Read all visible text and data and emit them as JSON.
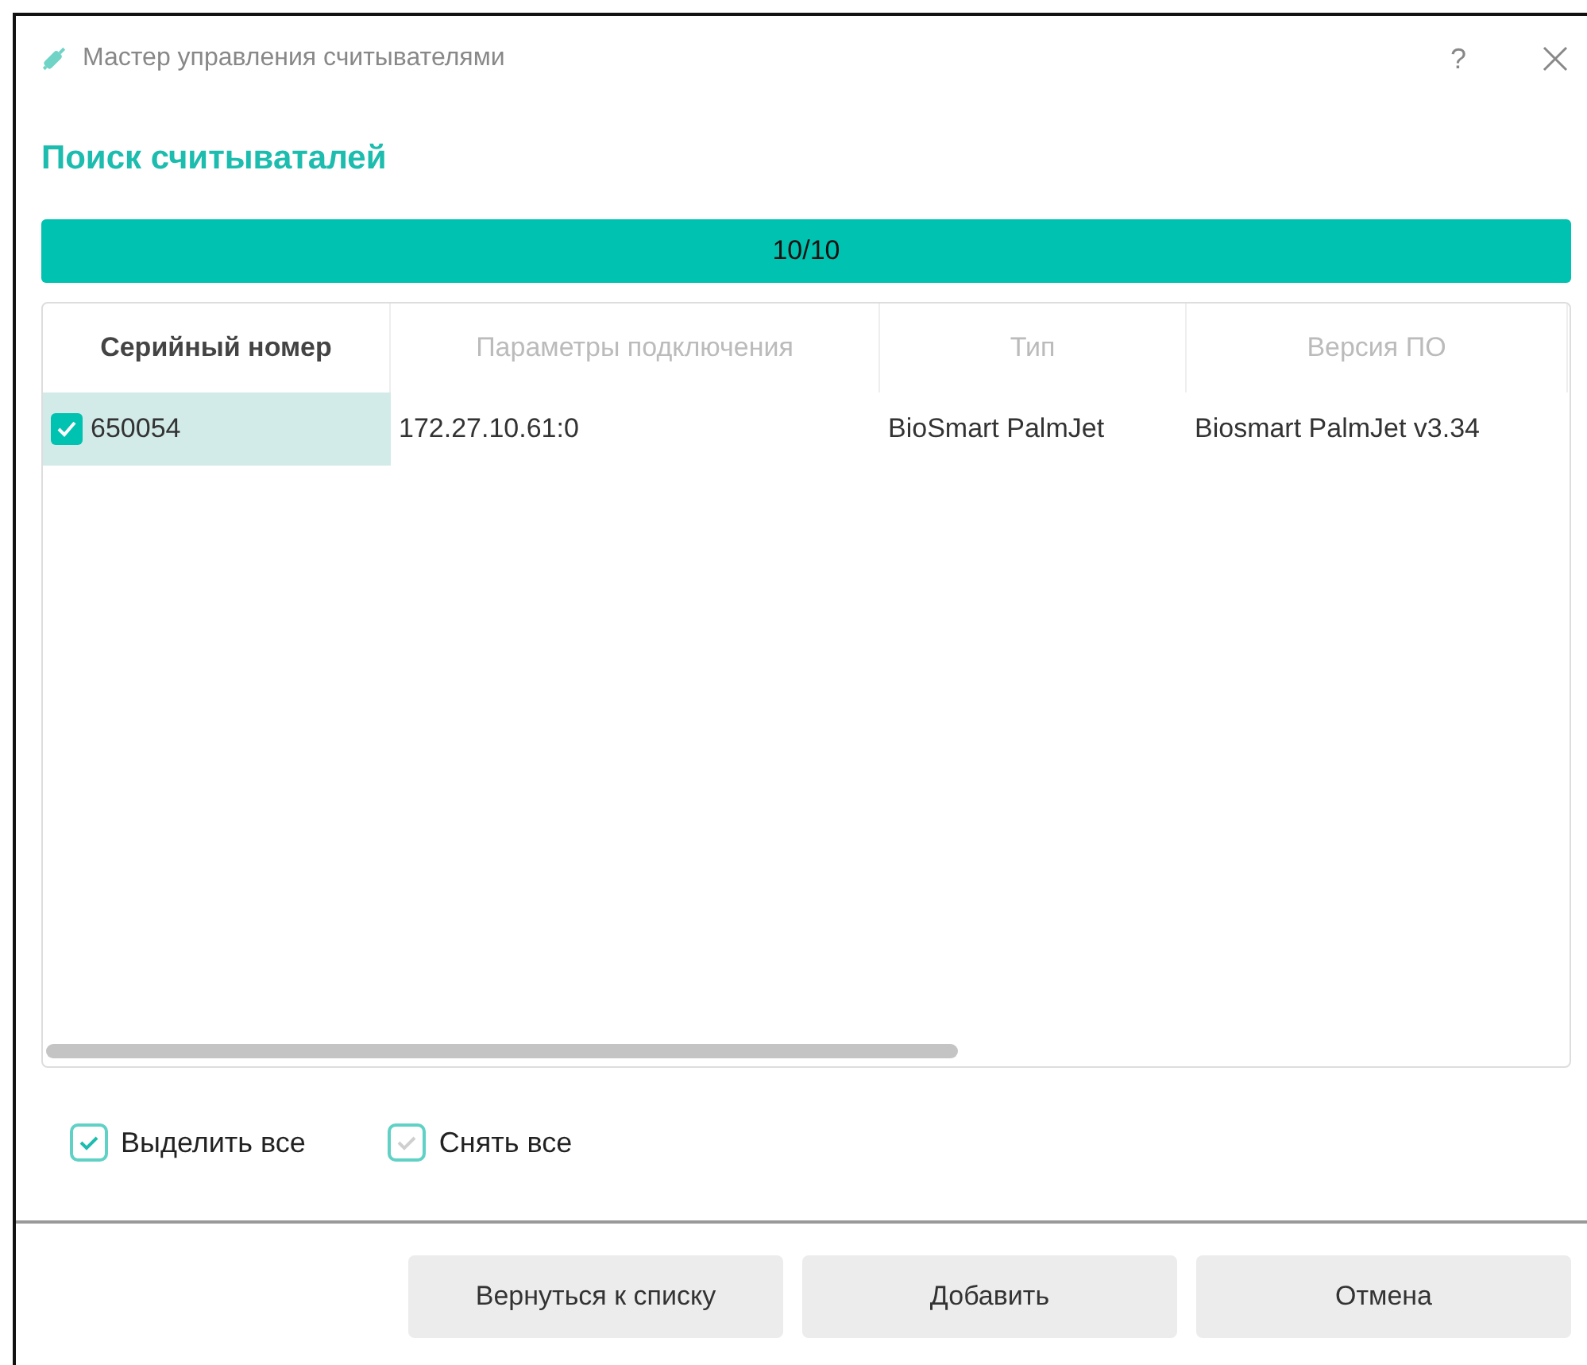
{
  "window": {
    "title": "Мастер управления считывателями",
    "help": "?"
  },
  "heading": "Поиск считываталей",
  "progress": {
    "level": 1,
    "reading": "10/10"
  },
  "table": {
    "columns": [
      {
        "label": "Серийный номер",
        "selected": true
      },
      {
        "label": "Параметры подключения",
        "selected": false
      },
      {
        "label": "Тип",
        "selected": false
      },
      {
        "label": "Версия ПО",
        "selected": false
      }
    ],
    "rows": [
      {
        "checked": true,
        "selected": true,
        "cells": [
          "650054",
          "172.27.10.61:0",
          "BioSmart PalmJet",
          "Biosmart PalmJet v3.34"
        ]
      }
    ]
  },
  "options": [
    {
      "label": "Выделить все",
      "disabled": false
    },
    {
      "label": "Снять все",
      "disabled": true
    }
  ],
  "buttons": [
    "Вернуться к списку",
    "Добавить",
    "Отмена"
  ]
}
